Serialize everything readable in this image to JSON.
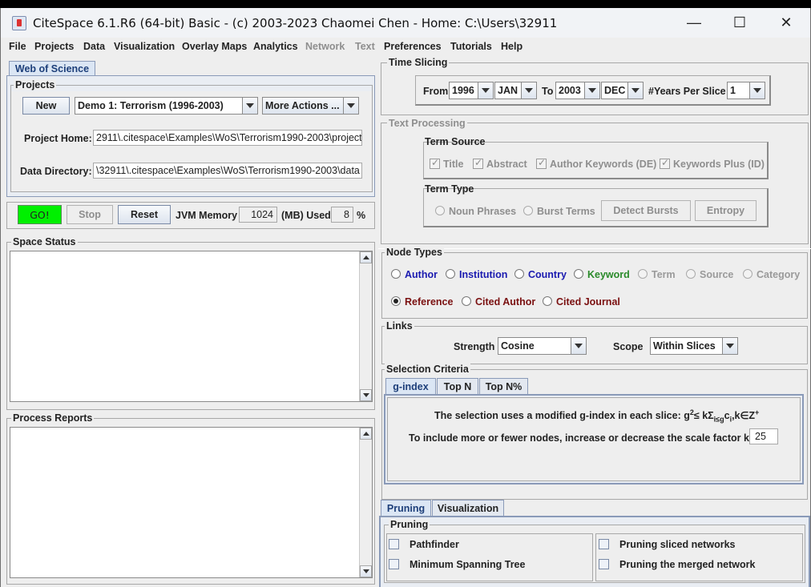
{
  "window": {
    "title": "CiteSpace 6.1.R6 (64-bit) Basic - (c) 2003-2023 Chaomei Chen - Home: C:\\Users\\32911",
    "controls": {
      "minimize": "—",
      "maximize": "☐",
      "close": "✕"
    }
  },
  "menubar": {
    "items": [
      {
        "label": "File",
        "enabled": true
      },
      {
        "label": "Projects",
        "enabled": true
      },
      {
        "label": "Data",
        "enabled": true
      },
      {
        "label": "Visualization",
        "enabled": true
      },
      {
        "label": "Overlay Maps",
        "enabled": true
      },
      {
        "label": "Analytics",
        "enabled": true
      },
      {
        "label": "Network",
        "enabled": false
      },
      {
        "label": "Text",
        "enabled": false
      },
      {
        "label": "Preferences",
        "enabled": true
      },
      {
        "label": "Tutorials",
        "enabled": true
      },
      {
        "label": "Help",
        "enabled": true
      }
    ]
  },
  "left": {
    "source_tab": "Web of Science",
    "projects": {
      "title": "Projects",
      "new_button": "New",
      "project_select": "Demo 1: Terrorism (1996-2003)",
      "more_actions": "More Actions ...",
      "home_label": "Project Home:",
      "home_value": "2911\\.citespace\\Examples\\WoS\\Terrorism1990-2003\\project",
      "data_label": "Data Directory:",
      "data_value": "\\32911\\.citespace\\Examples\\WoS\\Terrorism1990-2003\\data"
    },
    "run": {
      "go": "GO!",
      "stop": "Stop",
      "reset": "Reset",
      "jvm_label": "JVM Memory",
      "jvm_value": "1024",
      "used_label": "(MB) Used",
      "used_value": "8",
      "percent": "%"
    },
    "space_status": "Space Status",
    "process_reports": "Process Reports"
  },
  "right": {
    "time_slicing": {
      "title": "Time Slicing",
      "from_label": "From",
      "from_year": "1996",
      "from_month": "JAN",
      "to_label": "To",
      "to_year": "2003",
      "to_month": "DEC",
      "years_label": "#Years Per Slice",
      "years_value": "1"
    },
    "text_processing": {
      "title": "Text Processing",
      "term_source": "Term Source",
      "sources": [
        "Title",
        "Abstract",
        "Author Keywords (DE)",
        "Keywords Plus (ID)"
      ],
      "term_type": "Term Type",
      "noun_phrases": "Noun Phrases",
      "burst_terms": "Burst Terms",
      "detect_bursts": "Detect Bursts",
      "entropy": "Entropy"
    },
    "node_types": {
      "title": "Node Types",
      "row1": [
        {
          "label": "Author",
          "color": "#1a1ab0"
        },
        {
          "label": "Institution",
          "color": "#1a1ab0"
        },
        {
          "label": "Country",
          "color": "#1a1ab0"
        },
        {
          "label": "Keyword",
          "color": "#2a8a2a"
        },
        {
          "label": "Term",
          "color": "#9a9a9a"
        },
        {
          "label": "Source",
          "color": "#9a9a9a"
        },
        {
          "label": "Category",
          "color": "#9a9a9a"
        }
      ],
      "row2": [
        {
          "label": "Reference",
          "color": "#7a1010"
        },
        {
          "label": "Cited Author",
          "color": "#7a1010"
        },
        {
          "label": "Cited Journal",
          "color": "#7a1010"
        }
      ]
    },
    "links": {
      "title": "Links",
      "strength_label": "Strength",
      "strength_value": "Cosine",
      "scope_label": "Scope",
      "scope_value": "Within Slices"
    },
    "selection": {
      "title": "Selection Criteria",
      "tabs": [
        "g-index",
        "Top N",
        "Top N%"
      ],
      "formula_prefix": "The selection uses a modified g-index in each slice: g",
      "formula_sup": "2",
      "formula_mid": "≤ k",
      "formula_sum": "Σ",
      "formula_sub": "i≤g",
      "formula_c": "c",
      "formula_ci": "i",
      "formula_tail": ",k∈Z",
      "formula_plus": "+",
      "scale_text": "To include more or fewer nodes, increase or decrease the scale factor k =",
      "k_value": "25"
    },
    "bottom_tabs": [
      "Pruning",
      "Visualization"
    ],
    "pruning": {
      "title": "Pruning",
      "pathfinder": "Pathfinder",
      "mst": "Minimum Spanning Tree",
      "sliced": "Pruning sliced networks",
      "merged": "Pruning the merged network"
    }
  },
  "colors": {
    "go_green": "#00f000",
    "panel_bg": "#eeeeee"
  }
}
